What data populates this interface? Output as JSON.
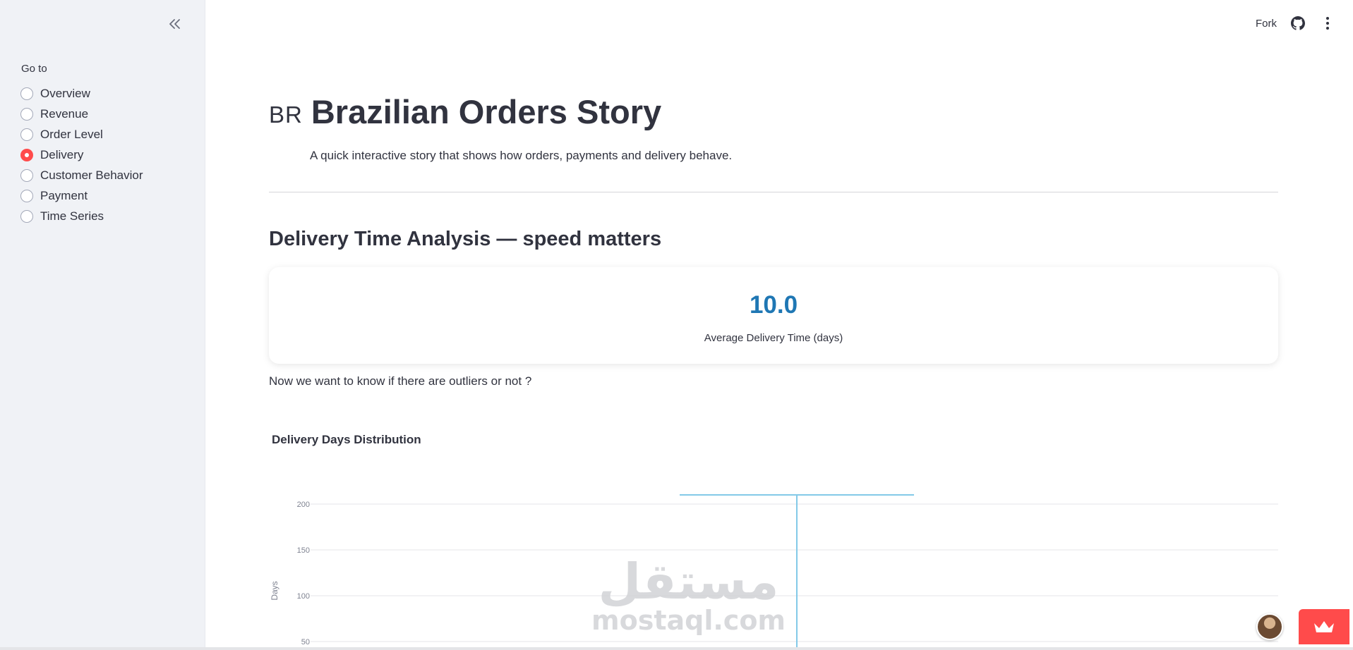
{
  "sidebar": {
    "goto_label": "Go to",
    "items": [
      {
        "label": "Overview",
        "selected": false
      },
      {
        "label": "Revenue",
        "selected": false
      },
      {
        "label": "Order Level",
        "selected": false
      },
      {
        "label": "Delivery",
        "selected": true
      },
      {
        "label": "Customer Behavior",
        "selected": false
      },
      {
        "label": "Payment",
        "selected": false
      },
      {
        "label": "Time Series",
        "selected": false
      }
    ]
  },
  "toolbar": {
    "fork_label": "Fork",
    "icons": [
      "github-icon",
      "more-vertical-icon"
    ]
  },
  "header": {
    "flag": "BR",
    "title": "Brazilian Orders Story",
    "subtitle": "A quick interactive story that shows how orders, payments and delivery behave."
  },
  "section": {
    "title": "Delivery Time Analysis — speed matters"
  },
  "metric": {
    "value": "10.0",
    "label": "Average Delivery Time (days)"
  },
  "outlier_text": "Now we want to know if there are outliers or not ?",
  "chart_data": {
    "type": "box",
    "title": "Delivery Days Distribution",
    "ylabel": "Days",
    "xlabel": "",
    "yticks": [
      50,
      100,
      150,
      200
    ],
    "upper_whisker": 210,
    "grid": true
  },
  "watermark": {
    "arabic": "مستقل",
    "latin": "mostaql.com"
  },
  "colors": {
    "accent": "#ff4b4b",
    "metric": "#1f77b4",
    "box_line": "#83c9e8",
    "sidebar_bg": "#f0f2f6"
  }
}
